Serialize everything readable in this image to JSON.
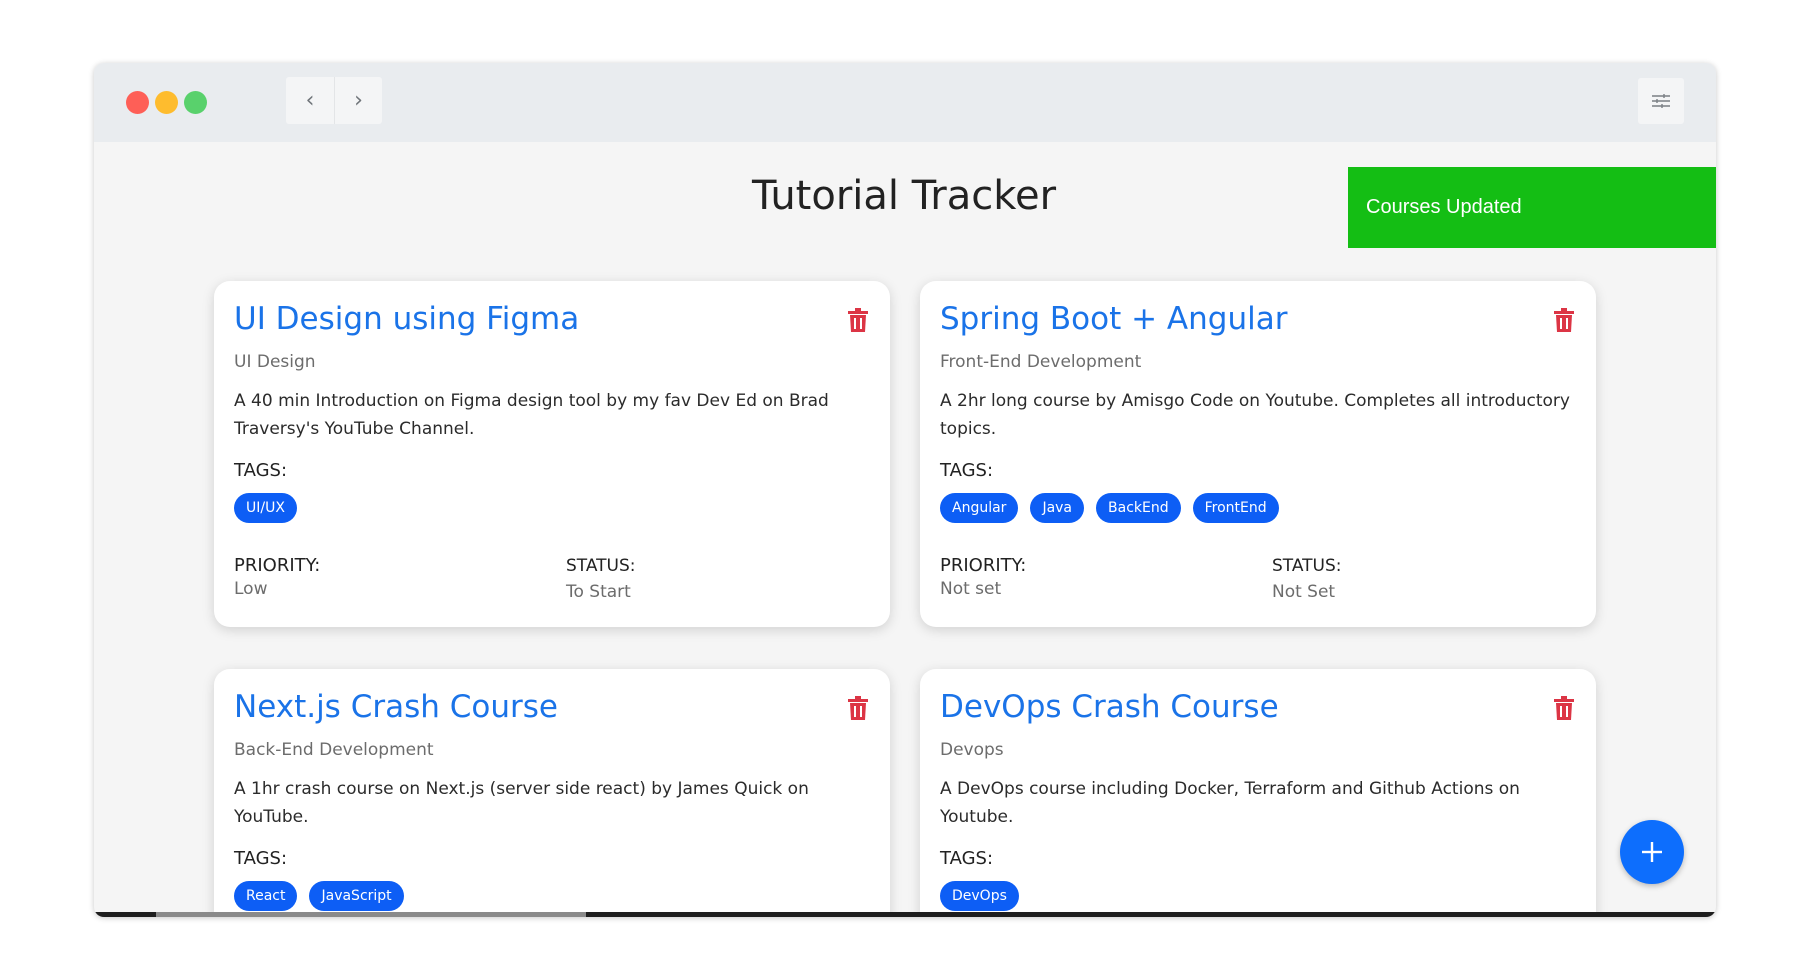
{
  "app": {
    "title": "Tutorial Tracker"
  },
  "toolbar": {
    "back_icon": "chevron-left-icon",
    "forward_icon": "chevron-right-icon",
    "settings_icon": "sliders-icon",
    "back_glyph": "‹",
    "forward_glyph": "›"
  },
  "toast": {
    "message": "Courses Updated",
    "color": "#14be14"
  },
  "labels": {
    "tags": "TAGS:",
    "priority": "PRIORITY:",
    "status": "STATUS:"
  },
  "colors": {
    "accent": "#1a73e8",
    "tag": "#0d5ef5",
    "danger": "#dc3545",
    "fab": "#0d6efd"
  },
  "courses": [
    {
      "title": "UI Design using Figma",
      "category": "UI Design",
      "description": "A 40 min Introduction on Figma design tool by my fav Dev Ed on Brad Traversy's YouTube Channel.",
      "tags": [
        "UI/UX"
      ],
      "priority": "Low",
      "status": "To Start"
    },
    {
      "title": "Spring Boot + Angular",
      "category": "Front-End Development",
      "description": "A 2hr long course by Amisgo Code on Youtube. Completes all introductory topics.",
      "tags": [
        "Angular",
        "Java",
        "BackEnd",
        "FrontEnd"
      ],
      "priority": "Not set",
      "status": "Not Set"
    },
    {
      "title": "Next.js Crash Course",
      "category": "Back-End Development",
      "description": "A 1hr crash course on Next.js (server side react) by James Quick on YouTube.",
      "tags": [
        "React",
        "JavaScript"
      ]
    },
    {
      "title": "DevOps Crash Course",
      "category": "Devops",
      "description": "A DevOps course including Docker, Terraform and Github Actions on Youtube.",
      "tags": [
        "DevOps"
      ]
    }
  ],
  "fab": {
    "icon": "plus-icon",
    "glyph": "+"
  }
}
